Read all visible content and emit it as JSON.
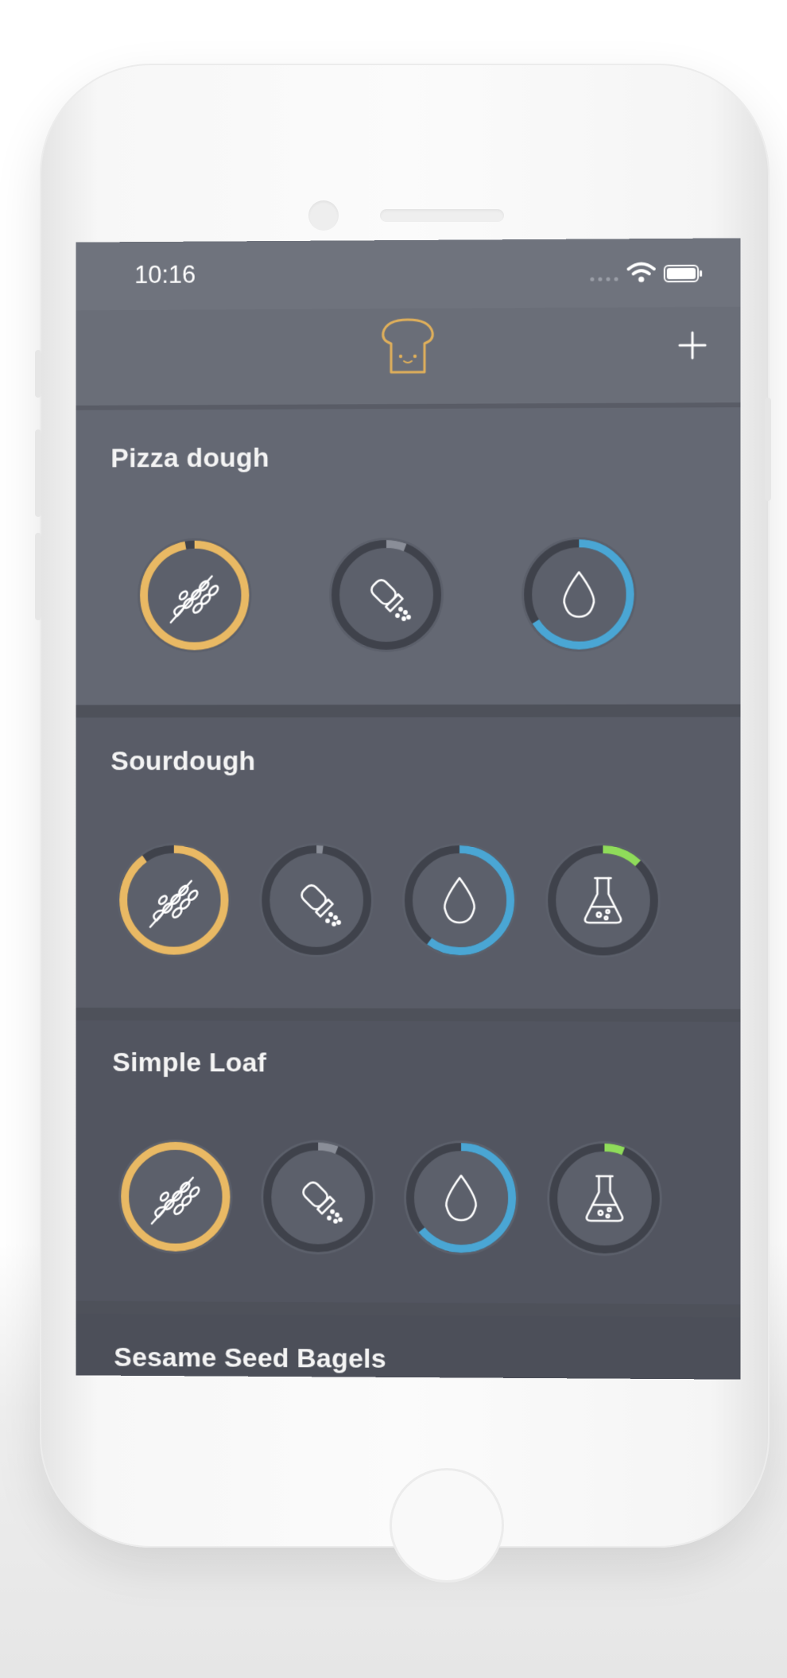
{
  "status_bar": {
    "time": "10:16"
  },
  "nav": {
    "logo": "toast-icon",
    "add_icon": "plus-icon"
  },
  "colors": {
    "flour": "#e9b964",
    "salt": "#8a8e98",
    "water": "#4aa6d4",
    "yeast": "#8fdc5a",
    "track": "#3f424b",
    "disc": "#5c606b"
  },
  "recipes": [
    {
      "title": "Pizza dough",
      "ingredients": [
        {
          "name": "flour",
          "icon": "wheat-icon",
          "progress": 0.97
        },
        {
          "name": "salt",
          "icon": "salt-shaker-icon",
          "progress": 0.06
        },
        {
          "name": "water",
          "icon": "water-drop-icon",
          "progress": 0.66
        }
      ]
    },
    {
      "title": "Sourdough",
      "ingredients": [
        {
          "name": "flour",
          "icon": "wheat-icon",
          "progress": 0.9
        },
        {
          "name": "salt",
          "icon": "salt-shaker-icon",
          "progress": 0.02
        },
        {
          "name": "water",
          "icon": "water-drop-icon",
          "progress": 0.6
        },
        {
          "name": "yeast",
          "icon": "flask-icon",
          "progress": 0.12
        }
      ]
    },
    {
      "title": "Simple Loaf",
      "ingredients": [
        {
          "name": "flour",
          "icon": "wheat-icon",
          "progress": 1.0
        },
        {
          "name": "salt",
          "icon": "salt-shaker-icon",
          "progress": 0.06
        },
        {
          "name": "water",
          "icon": "water-drop-icon",
          "progress": 0.64
        },
        {
          "name": "yeast",
          "icon": "flask-icon",
          "progress": 0.06
        }
      ]
    },
    {
      "title": "Sesame Seed Bagels",
      "ingredients": []
    }
  ]
}
